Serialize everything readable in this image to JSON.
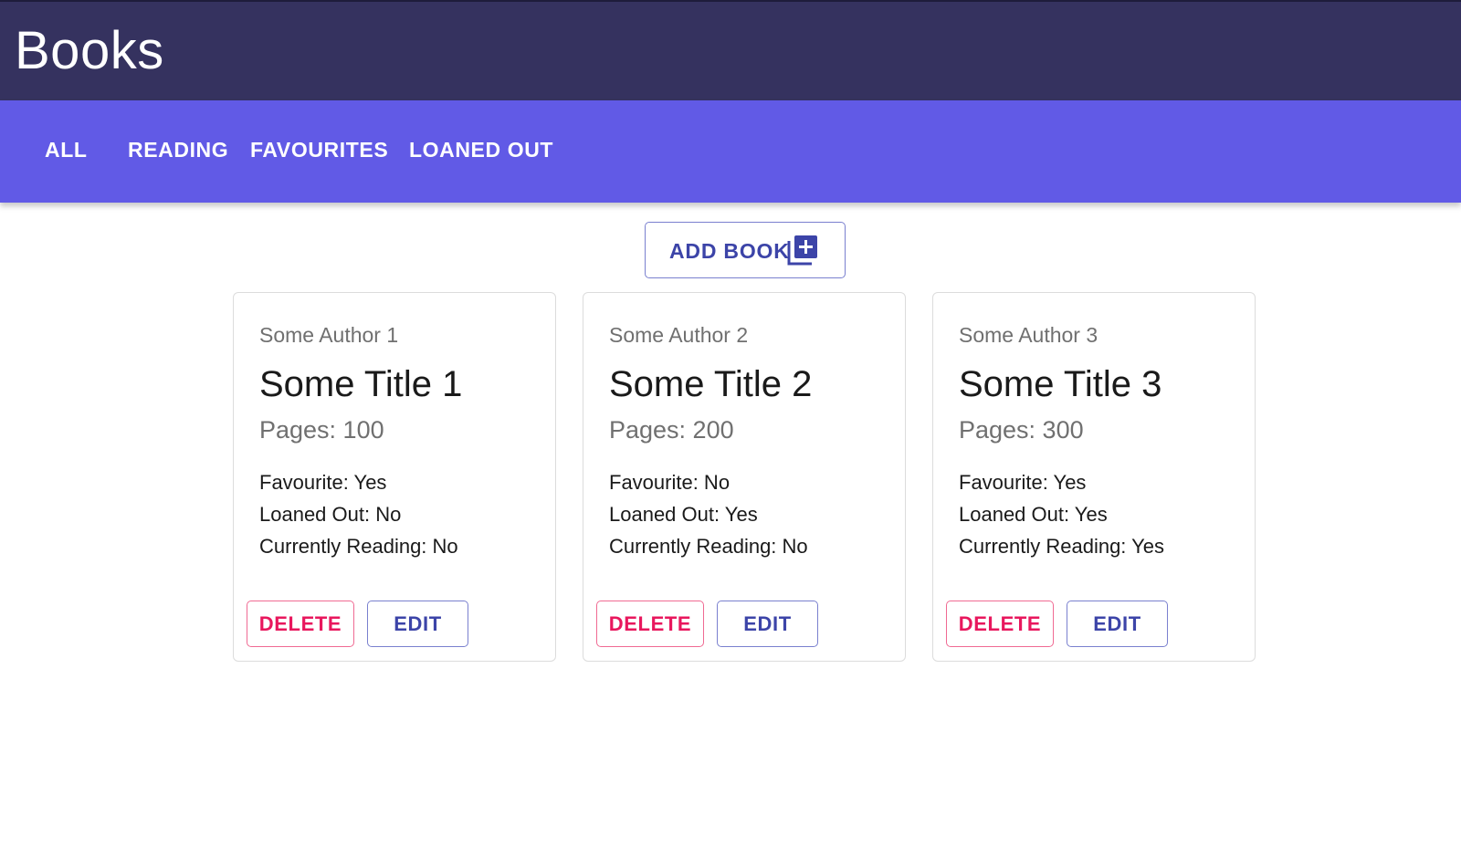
{
  "app": {
    "title": "Books"
  },
  "tabs": [
    {
      "label": "ALL"
    },
    {
      "label": "READING"
    },
    {
      "label": "FAVOURITES"
    },
    {
      "label": "LOANED OUT"
    }
  ],
  "toolbar": {
    "add_book_label": "ADD BOOK",
    "add_book_icon": "library-add-icon"
  },
  "books": [
    {
      "author": "Some Author 1",
      "title": "Some Title 1",
      "pages": "Pages: 100",
      "favourite": "Favourite: Yes",
      "loaned_out": "Loaned Out: No",
      "currently_reading": "Currently Reading: No",
      "delete_label": "DELETE",
      "edit_label": "EDIT"
    },
    {
      "author": "Some Author 2",
      "title": "Some Title 2",
      "pages": "Pages: 200",
      "favourite": "Favourite: No",
      "loaned_out": "Loaned Out: Yes",
      "currently_reading": "Currently Reading: No",
      "delete_label": "DELETE",
      "edit_label": "EDIT"
    },
    {
      "author": "Some Author 3",
      "title": "Some Title 3",
      "pages": "Pages: 300",
      "favourite": "Favourite: Yes",
      "loaned_out": "Loaned Out: Yes",
      "currently_reading": "Currently Reading: Yes",
      "delete_label": "DELETE",
      "edit_label": "EDIT"
    }
  ],
  "colors": {
    "app_bar": "#35325f",
    "tab_bar": "#615ae6",
    "primary": "#3c44a8",
    "danger": "#e8175d"
  }
}
